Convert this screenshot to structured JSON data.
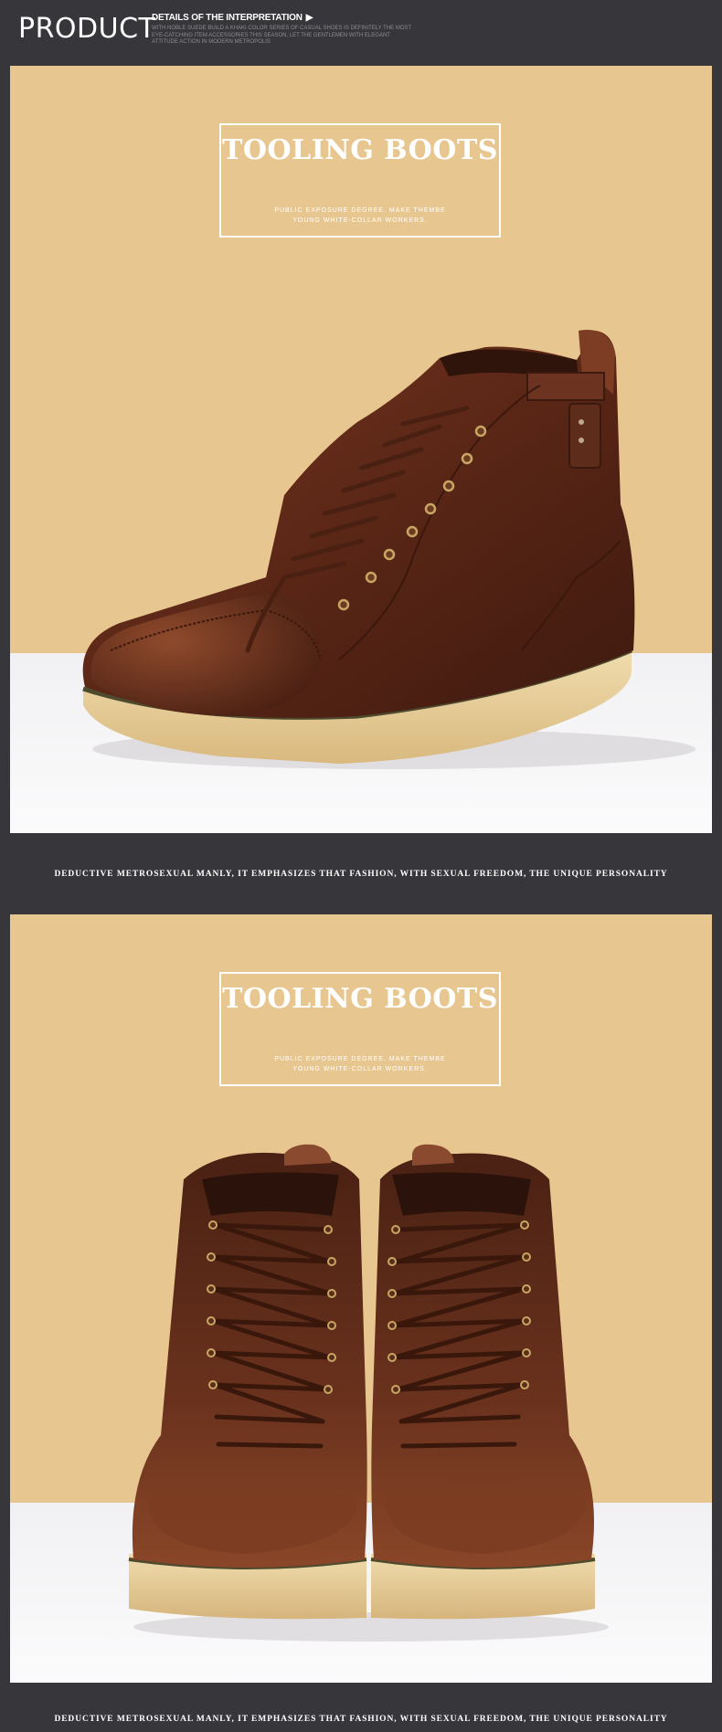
{
  "header": {
    "title": "PRODUCT",
    "interp_heading": "DETAILS OF THE INTERPRETATION",
    "interp_arrow": "▶",
    "interp_text": "WITH NOBLE SUEDE BUILD A KHAKI COLOR SERIES OF CASUAL SHOES IS DEFINITELY THE MOST EYE-CATCHING ITEM ACCESSORIES THIS SEASON, LET THE GENTLEMEN WITH ELEGANT ATTITUDE ACTION IN MODERN METROPOLIS"
  },
  "panels": [
    {
      "title": "TOOLING BOOTS",
      "subtitle": "PUBLIC EXPOSURE DEGREE. MAKE THEMBE YOUNG WHITE-COLLAR WORKERS.",
      "caption": "DEDUCTIVE METROSEXUAL MANLY, IT EMPHASIZES THAT FASHION, WITH SEXUAL FREEDOM, THE UNIQUE PERSONALITY"
    },
    {
      "title": "TOOLING BOOTS",
      "subtitle": "PUBLIC EXPOSURE DEGREE. MAKE THEMBE YOUNG WHITE-COLLAR WORKERS.",
      "caption": "DEDUCTIVE METROSEXUAL MANLY, IT EMPHASIZES THAT FASHION, WITH SEXUAL FREEDOM, THE UNIQUE PERSONALITY"
    }
  ],
  "colors": {
    "background": "#37363b",
    "panel": "#e8c68f",
    "floor": "#f3f2f4",
    "leather": "#5c2a1a",
    "sole": "#ead3a0"
  }
}
